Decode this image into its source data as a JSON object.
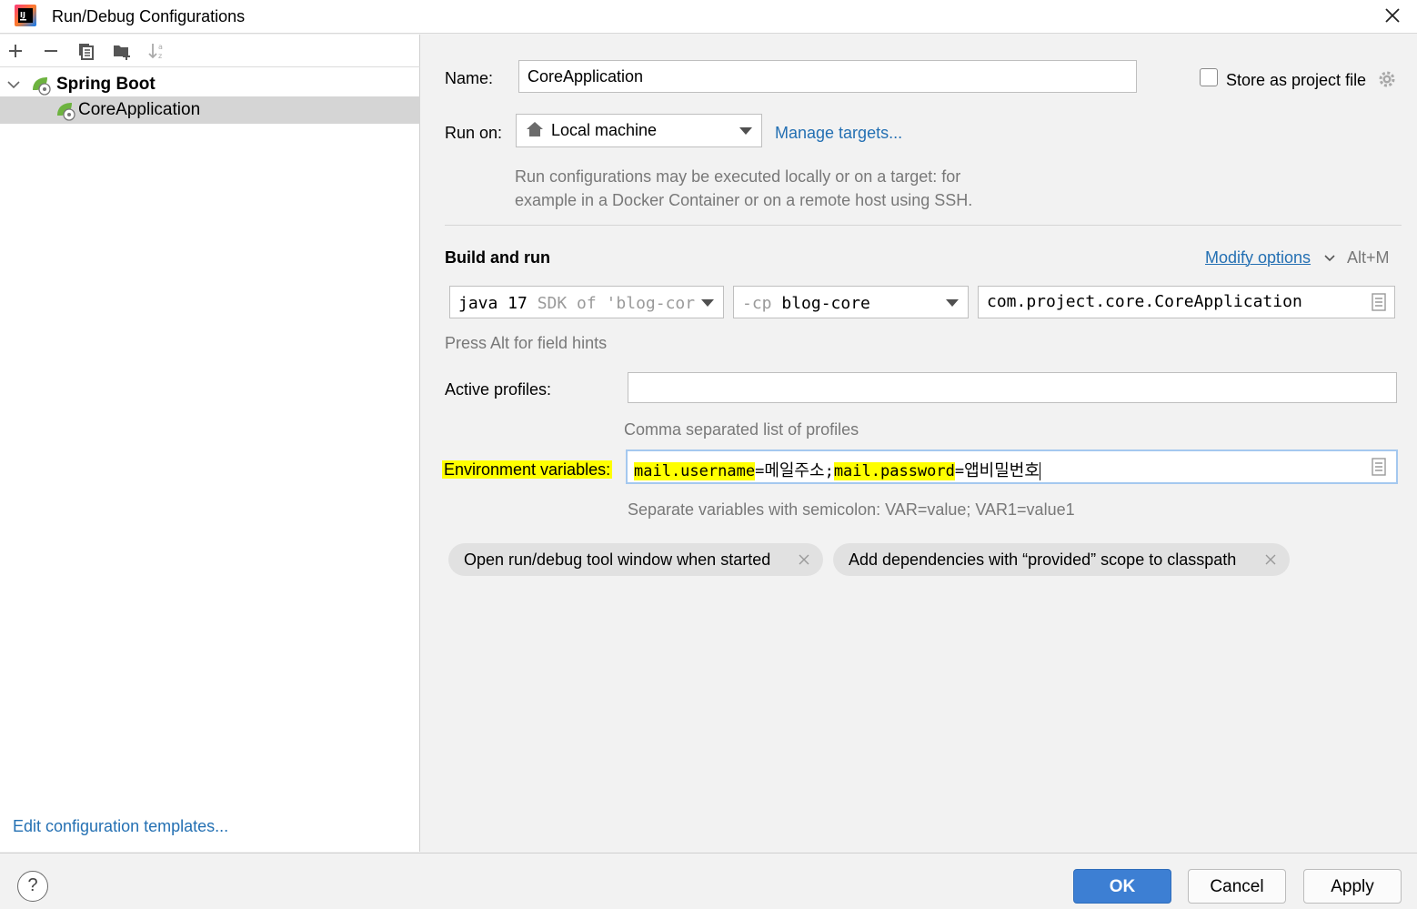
{
  "window": {
    "title": "Run/Debug Configurations"
  },
  "sidebar": {
    "group_label": "Spring Boot",
    "items": [
      {
        "label": "CoreApplication"
      }
    ],
    "edit_templates_link": "Edit configuration templates..."
  },
  "form": {
    "name_label": "Name:",
    "name_value": "CoreApplication",
    "store_label": "Store as project file",
    "store_checked": false,
    "run_on_label": "Run on:",
    "run_on_value": "Local machine",
    "manage_targets": "Manage targets...",
    "run_on_hint_line1": "Run configurations may be executed locally or on a target: for",
    "run_on_hint_line2": "example in a Docker Container or on a remote host using SSH.",
    "section_title": "Build and run",
    "modify_options": "Modify options",
    "modify_shortcut": "Alt+M",
    "jdk_main": "java 17",
    "jdk_hint": "SDK of 'blog-cor",
    "cp_prefix": "-cp",
    "cp_value": "blog-core",
    "main_class": "com.project.core.CoreApplication",
    "alt_hint": "Press Alt for field hints",
    "profiles_label": "Active profiles:",
    "profiles_value": "",
    "profiles_hint": "Comma separated list of profiles",
    "env_label": "Environment variables:",
    "env_parts": {
      "key1": "mail.username",
      "eq1": "=",
      "val1": "메일주소",
      "semi": ";",
      "key2": "mail.password",
      "eq2": "=",
      "val2": "앱비밀번호"
    },
    "env_hint": "Separate variables with semicolon: VAR=value; VAR1=value1",
    "chips": [
      {
        "label": "Open run/debug tool window when started"
      },
      {
        "label": "Add dependencies with “provided” scope to classpath"
      }
    ]
  },
  "buttons": {
    "ok": "OK",
    "cancel": "Cancel",
    "apply": "Apply",
    "help": "?"
  },
  "colors": {
    "accent": "#3d7fd3",
    "link": "#2470b3",
    "highlight": "#ffff00",
    "spring_green": "#6db33f"
  }
}
